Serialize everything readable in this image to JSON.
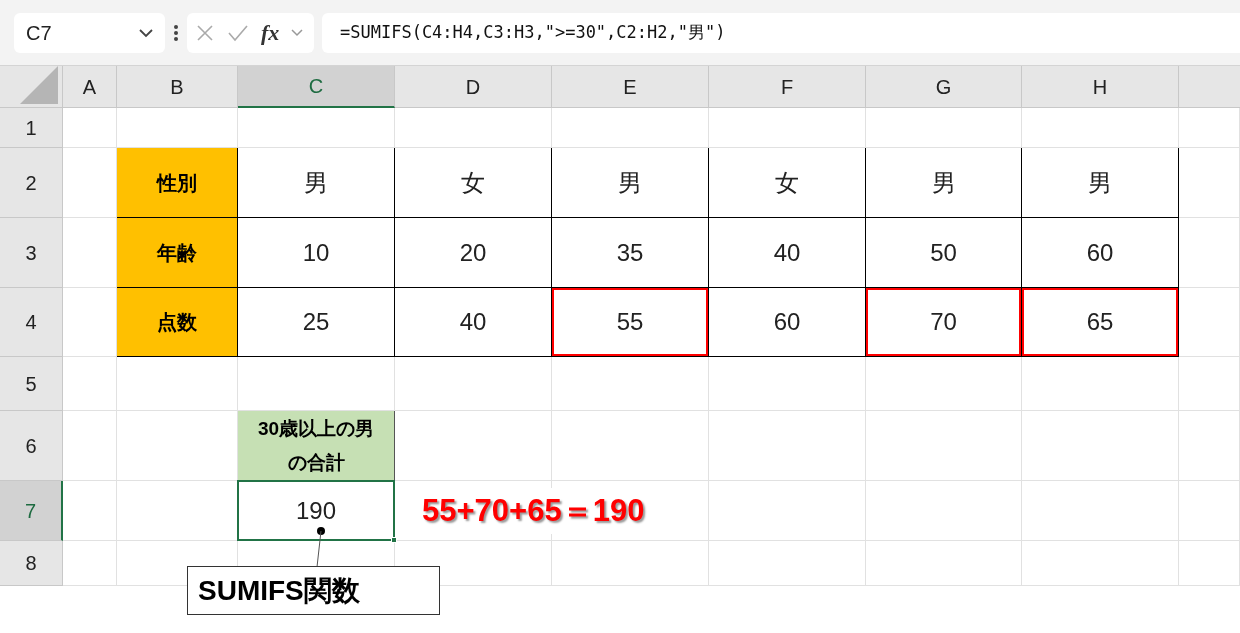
{
  "name_box": {
    "value": "C7"
  },
  "function_label": "fx",
  "formula_bar": {
    "value": "=SUMIFS(C4:H4,C3:H3,\">=30\",C2:H2,\"男\")"
  },
  "columns": [
    {
      "label": "A",
      "selected": false
    },
    {
      "label": "B",
      "selected": false
    },
    {
      "label": "C",
      "selected": true
    },
    {
      "label": "D",
      "selected": false
    },
    {
      "label": "E",
      "selected": false
    },
    {
      "label": "F",
      "selected": false
    },
    {
      "label": "G",
      "selected": false
    },
    {
      "label": "H",
      "selected": false
    }
  ],
  "rows": [
    {
      "label": "1",
      "selected": false
    },
    {
      "label": "2",
      "selected": false
    },
    {
      "label": "3",
      "selected": false
    },
    {
      "label": "4",
      "selected": false
    },
    {
      "label": "5",
      "selected": false
    },
    {
      "label": "6",
      "selected": false
    },
    {
      "label": "7",
      "selected": true
    },
    {
      "label": "8",
      "selected": false
    }
  ],
  "data_table": [
    {
      "header": "性別",
      "cells": [
        {
          "text": "男",
          "highlighted": false
        },
        {
          "text": "女",
          "highlighted": false
        },
        {
          "text": "男",
          "highlighted": false
        },
        {
          "text": "女",
          "highlighted": false
        },
        {
          "text": "男",
          "highlighted": false
        },
        {
          "text": "男",
          "highlighted": false
        }
      ]
    },
    {
      "header": "年齢",
      "cells": [
        {
          "text": "10",
          "highlighted": false
        },
        {
          "text": "20",
          "highlighted": false
        },
        {
          "text": "35",
          "highlighted": false
        },
        {
          "text": "40",
          "highlighted": false
        },
        {
          "text": "50",
          "highlighted": false
        },
        {
          "text": "60",
          "highlighted": false
        }
      ]
    },
    {
      "header": "点数",
      "cells": [
        {
          "text": "25",
          "highlighted": false
        },
        {
          "text": "40",
          "highlighted": false
        },
        {
          "text": "55",
          "highlighted": true
        },
        {
          "text": "60",
          "highlighted": false
        },
        {
          "text": "70",
          "highlighted": true
        },
        {
          "text": "65",
          "highlighted": true
        }
      ]
    }
  ],
  "result": {
    "header": "30歳以上の男の合計",
    "value": "190",
    "selected": true
  },
  "annotation": "55+70+65＝190",
  "callout": "SUMIFS関数"
}
